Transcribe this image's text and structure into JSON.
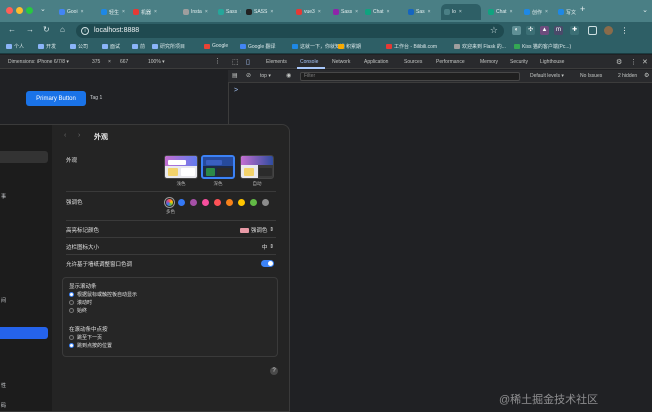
{
  "browser": {
    "tabs": [
      {
        "label": "Gooi",
        "color": "#4285f4"
      },
      {
        "label": "轻生",
        "color": "#1e88e5"
      },
      {
        "label": "机器",
        "color": "#e53935"
      },
      {
        "label": "Insta",
        "color": "#9e9e9e"
      },
      {
        "label": "Sass",
        "color": "#26a69a"
      },
      {
        "label": "SASS",
        "color": "#212121"
      },
      {
        "label": "vue3",
        "color": "#e53935"
      },
      {
        "label": "Sass",
        "color": "#8e24aa"
      },
      {
        "label": "Chat",
        "color": "#10a37f"
      },
      {
        "label": "Sas",
        "color": "#1565c0"
      },
      {
        "label": "lo",
        "color": "#4a7f85"
      },
      {
        "label": "Chat",
        "color": "#10a37f"
      },
      {
        "label": "创作",
        "color": "#1e88e5"
      },
      {
        "label": "写文",
        "color": "#1e88e5"
      }
    ],
    "new_tab_label": "+",
    "url": "localhost:8888",
    "bookmarks": [
      "个人",
      "开发",
      "公司",
      "面试",
      "前",
      "研究所项目",
      "Google",
      "Google 翻译",
      "这就一下，你就知道",
      "积累期",
      "工作台 - Bilibili.com",
      "欢迎来到 Flask 的...",
      "Kiss 猫的客户端(Pc...)"
    ],
    "bookmark_colors": [
      "#8ab4f8",
      "#8ab4f8",
      "#8ab4f8",
      "#8ab4f8",
      "#8ab4f8",
      "#8ab4f8",
      "#ea4335",
      "#4285f4",
      "#1e88e5",
      "#f9ab00",
      "#e53935",
      "#9e9e9e",
      "#34a853"
    ]
  },
  "device_toolbar": {
    "dimensions": "Dimensions: iPhone 6/7/8 ▾",
    "width": "375",
    "times": "×",
    "height": "667",
    "zoom": "100% ▾"
  },
  "devtools": {
    "tabs": [
      "Elements",
      "Console",
      "Network",
      "Application",
      "Sources",
      "Performance",
      "Memory",
      "Security",
      "Lighthouse"
    ],
    "active_tab": "Console",
    "context": "top ▾",
    "filter_placeholder": "Filter",
    "levels": "Default levels ▾",
    "issues": "No Issues",
    "hidden": "2 hidden",
    "prompt": ">"
  },
  "page": {
    "primary_button": "Primary Button",
    "tag": "Tag 1"
  },
  "settings": {
    "nav_back": "‹",
    "nav_forward": "›",
    "title": "外观",
    "appearance_label": "外观",
    "themes": [
      "浅色",
      "深色",
      "自动"
    ],
    "accent_label": "强调色",
    "accent_colors": [
      "#7d5bd6",
      "#3478f6",
      "#a550a7",
      "#f74f9e",
      "#ff5257",
      "#f7821b",
      "#ffc600",
      "#62ba46",
      "#8c8c8c"
    ],
    "accent_caption": "多色",
    "highlight_label": "高亮标记颜色",
    "highlight_value": "强调色",
    "sidebar_icon_label": "边栏图标大小",
    "sidebar_icon_value": "中",
    "tint_label": "允许基于墙纸调整窗口色调",
    "scrollbar_label": "显示滚动条",
    "scrollbar_options": [
      "根据鼠标或触控板自动显示",
      "滚动时",
      "始终"
    ],
    "click_label": "在滚动条中点按",
    "click_options": [
      "跳至下一页",
      "跳到点按的位置"
    ],
    "help": "?",
    "sidebar_labels": [
      "事",
      "间",
      "性",
      "码"
    ]
  },
  "watermark": "@稀土掘金技术社区"
}
